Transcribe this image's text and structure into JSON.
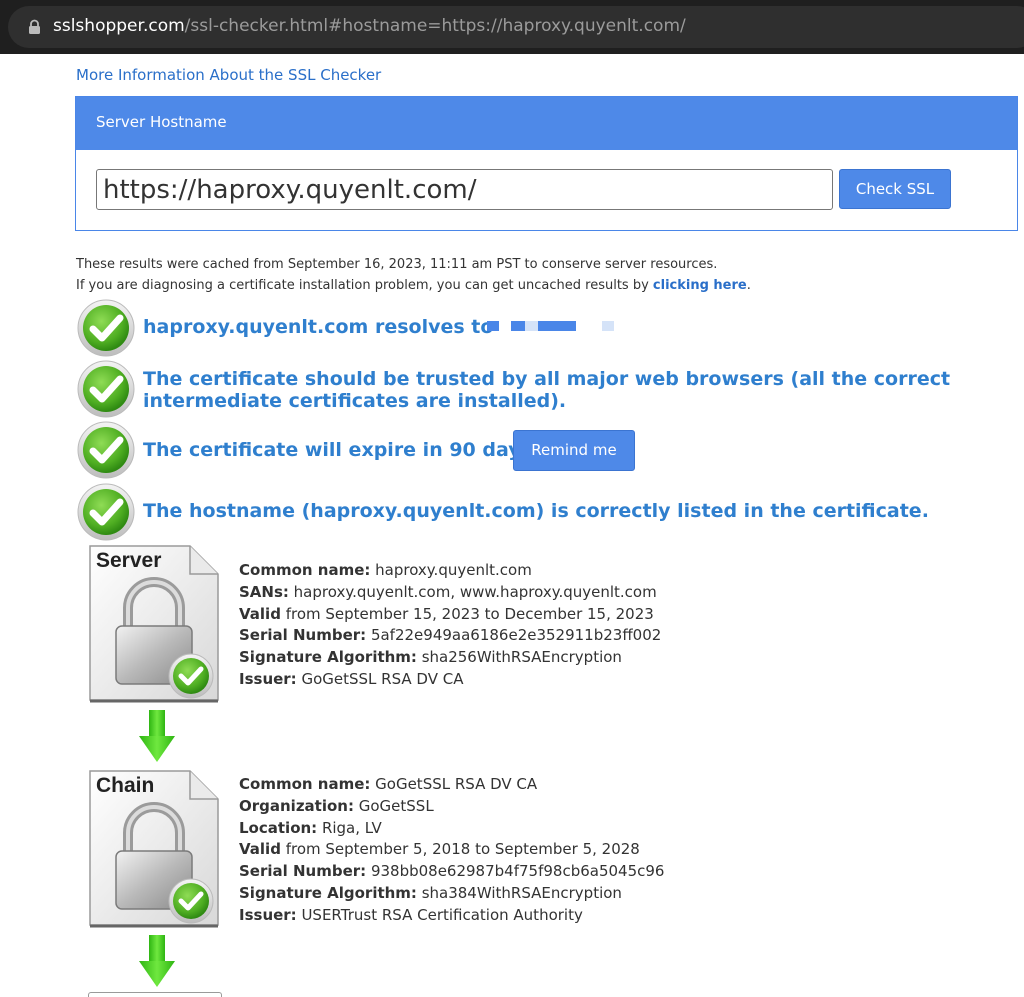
{
  "browser": {
    "url_host": "sslshopper.com",
    "url_path": "/ssl-checker.html#hostname=https://haproxy.quyenlt.com/"
  },
  "page": {
    "info_link": "More Information About the SSL Checker",
    "form": {
      "header": "Server Hostname",
      "hostname_value": "https://haproxy.quyenlt.com/",
      "check_button": "Check SSL"
    },
    "cache_notice_line1": "These results were cached from September 16, 2023, 11:11 am PST to conserve server resources.",
    "cache_notice_line2_prefix": "If you are diagnosing a certificate installation problem, you can get uncached results by ",
    "cache_notice_link": "clicking here",
    "cache_notice_suffix": ".",
    "results": {
      "resolves": "haproxy.quyenlt.com resolves to",
      "trusted": "The certificate should be trusted by all major web browsers (all the correct intermediate certificates are installed).",
      "expire": "The certificate will expire in 90 days.",
      "remind_button": "Remind me",
      "hostname": "The hostname (haproxy.quyenlt.com) is correctly listed in the certificate."
    },
    "server_cert": {
      "icon_label": "Server",
      "rows": [
        {
          "label": "Common name:",
          "value": " haproxy.quyenlt.com"
        },
        {
          "label": "SANs:",
          "value": " haproxy.quyenlt.com, www.haproxy.quyenlt.com"
        },
        {
          "label": "Valid",
          "value": " from September 15, 2023 to December 15, 2023"
        },
        {
          "label": "Serial Number:",
          "value": " 5af22e949aa6186e2e352911b23ff002"
        },
        {
          "label": "Signature Algorithm:",
          "value": " sha256WithRSAEncryption"
        },
        {
          "label": "Issuer:",
          "value": " GoGetSSL RSA DV CA"
        }
      ]
    },
    "chain_cert": {
      "icon_label": "Chain",
      "rows": [
        {
          "label": "Common name:",
          "value": " GoGetSSL RSA DV CA"
        },
        {
          "label": "Organization:",
          "value": " GoGetSSL"
        },
        {
          "label": "Location:",
          "value": " Riga, LV"
        },
        {
          "label": "Valid",
          "value": " from September 5, 2018 to September 5, 2028"
        },
        {
          "label": "Serial Number:",
          "value": " 938bb08e62987b4f75f98cb6a5045c96"
        },
        {
          "label": "Signature Algorithm:",
          "value": " sha384WithRSAEncryption"
        },
        {
          "label": "Issuer:",
          "value": " USERTrust RSA Certification Authority"
        }
      ]
    }
  },
  "colors": {
    "accent": "#4e89e8",
    "result_text": "#2f7fce",
    "check_green": "#5cb82e",
    "arrow_green": "#35c417"
  },
  "icons": [
    "lock-icon",
    "green-check-icon",
    "certificate-padlock-icon",
    "green-down-arrow-icon"
  ]
}
